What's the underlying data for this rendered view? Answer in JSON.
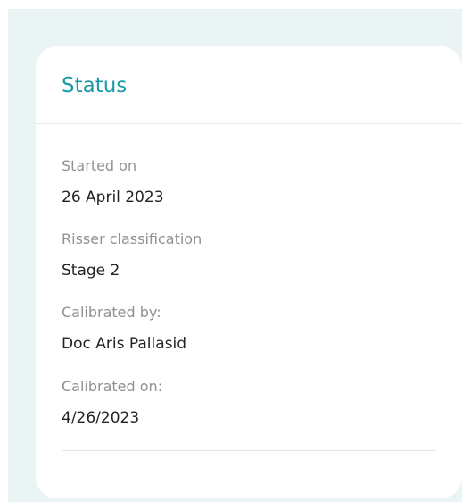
{
  "status_card": {
    "title": "Status",
    "fields": [
      {
        "label": "Started on",
        "value": "26 April 2023"
      },
      {
        "label": "Risser classification",
        "value": "Stage 2"
      },
      {
        "label": "Calibrated by:",
        "value": "Doc Aris Pallasid"
      },
      {
        "label": "Calibrated on:",
        "value": "4/26/2023"
      }
    ]
  },
  "colors": {
    "page_background": "#eaf4f5",
    "card_background": "#ffffff",
    "title_accent": "#1b9aa5",
    "label_text": "#8f9193",
    "value_text": "#1f2325",
    "divider": "#e3e5e7"
  }
}
